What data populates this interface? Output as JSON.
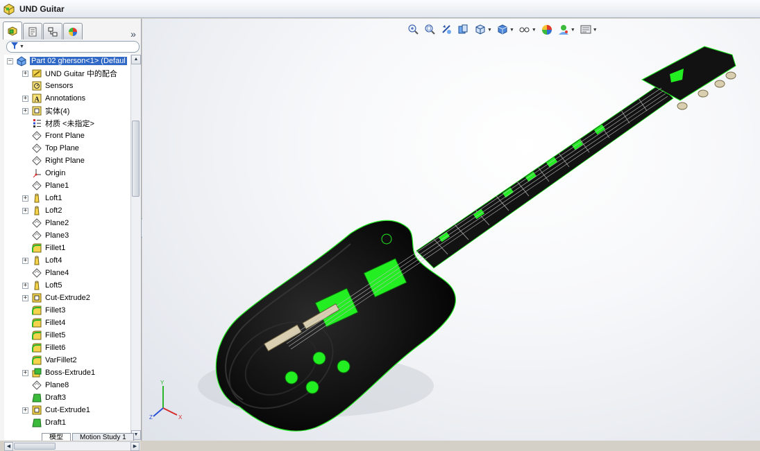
{
  "window": {
    "title": "UND Guitar"
  },
  "feature_manager": {
    "tabs": [
      "featuremanager-tree-icon",
      "propertymanager-icon",
      "configurationmanager-icon",
      "displaymanager-icon"
    ],
    "expand_glyph": "»",
    "filter_icon": "filter-icon",
    "items": [
      {
        "label": "Part 02 gherson<1> (Defaul",
        "icon": "part-icon",
        "expandable": "minus",
        "selected": true
      },
      {
        "label": "UND Guitar 中的配合",
        "icon": "mates-icon",
        "expandable": "plus"
      },
      {
        "label": "Sensors",
        "icon": "sensor-icon",
        "expandable": ""
      },
      {
        "label": "Annotations",
        "icon": "annotation-icon",
        "expandable": "plus"
      },
      {
        "label": "实体(4)",
        "icon": "solid-bodies-icon",
        "expandable": "plus"
      },
      {
        "label": "材质 <未指定>",
        "icon": "material-icon",
        "expandable": ""
      },
      {
        "label": "Front Plane",
        "icon": "plane-icon",
        "expandable": ""
      },
      {
        "label": "Top Plane",
        "icon": "plane-icon",
        "expandable": ""
      },
      {
        "label": "Right Plane",
        "icon": "plane-icon",
        "expandable": ""
      },
      {
        "label": "Origin",
        "icon": "origin-icon",
        "expandable": ""
      },
      {
        "label": "Plane1",
        "icon": "plane-icon",
        "expandable": ""
      },
      {
        "label": "Loft1",
        "icon": "loft-icon",
        "expandable": "plus"
      },
      {
        "label": "Loft2",
        "icon": "loft-icon",
        "expandable": "plus"
      },
      {
        "label": "Plane2",
        "icon": "plane-icon",
        "expandable": ""
      },
      {
        "label": "Plane3",
        "icon": "plane-icon",
        "expandable": ""
      },
      {
        "label": "Fillet1",
        "icon": "fillet-icon",
        "expandable": ""
      },
      {
        "label": "Loft4",
        "icon": "loft-icon",
        "expandable": "plus"
      },
      {
        "label": "Plane4",
        "icon": "plane-icon",
        "expandable": ""
      },
      {
        "label": "Loft5",
        "icon": "loft-icon",
        "expandable": "plus"
      },
      {
        "label": "Cut-Extrude2",
        "icon": "cut-extrude-icon",
        "expandable": "plus"
      },
      {
        "label": "Fillet3",
        "icon": "fillet-icon",
        "expandable": ""
      },
      {
        "label": "Fillet4",
        "icon": "fillet-icon",
        "expandable": ""
      },
      {
        "label": "Fillet5",
        "icon": "fillet-icon",
        "expandable": ""
      },
      {
        "label": "Fillet6",
        "icon": "fillet-icon",
        "expandable": ""
      },
      {
        "label": "VarFillet2",
        "icon": "fillet-icon",
        "expandable": ""
      },
      {
        "label": "Boss-Extrude1",
        "icon": "boss-extrude-icon",
        "expandable": "plus"
      },
      {
        "label": "Plane8",
        "icon": "plane-icon",
        "expandable": ""
      },
      {
        "label": "Draft3",
        "icon": "draft-icon",
        "expandable": ""
      },
      {
        "label": "Cut-Extrude1",
        "icon": "cut-extrude-icon",
        "expandable": "plus"
      },
      {
        "label": "Draft1",
        "icon": "draft-icon",
        "expandable": ""
      }
    ]
  },
  "bottom_tabs": [
    {
      "label": "模型",
      "active": true
    },
    {
      "label": "Motion Study 1",
      "active": false
    }
  ],
  "heads_up_toolbar": [
    {
      "icon": "zoom-to-fit-icon",
      "dropdown": false
    },
    {
      "icon": "zoom-to-area-icon",
      "dropdown": false
    },
    {
      "icon": "previous-view-icon",
      "dropdown": false
    },
    {
      "icon": "section-view-icon",
      "dropdown": false
    },
    {
      "icon": "view-orientation-icon",
      "dropdown": true
    },
    {
      "icon": "display-style-icon",
      "dropdown": true
    },
    {
      "icon": "hide-show-items-icon",
      "dropdown": true
    },
    {
      "icon": "edit-appearance-icon",
      "dropdown": false
    },
    {
      "icon": "apply-scene-icon",
      "dropdown": true
    },
    {
      "icon": "view-settings-icon",
      "dropdown": true
    }
  ],
  "model": {
    "name": "UND Guitar",
    "body_color": "#111111",
    "accent_color": "#22ee22",
    "hardware_color": "#d9cfb0"
  },
  "triad": {
    "axes": [
      "X",
      "Y",
      "Z"
    ]
  }
}
